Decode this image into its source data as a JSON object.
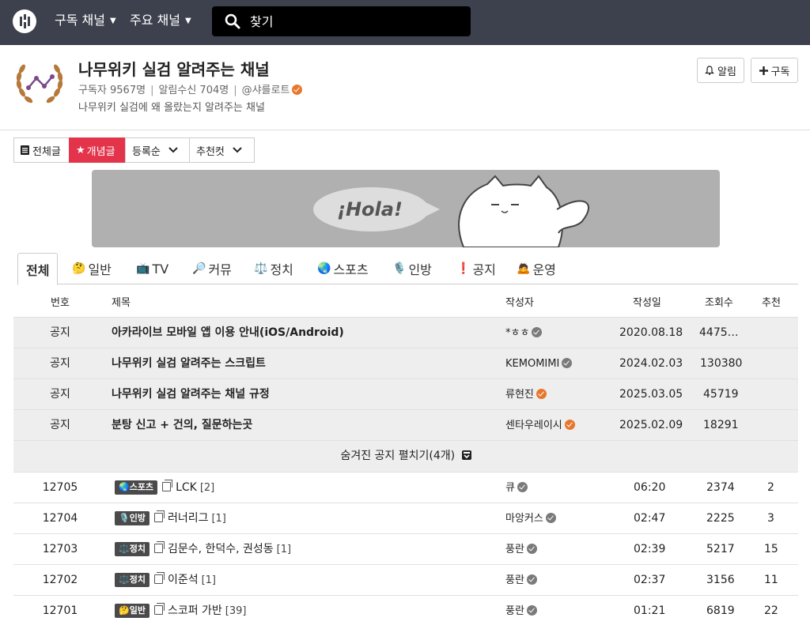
{
  "nav": {
    "menu1": "구독 채널",
    "menu2": "주요 채널",
    "search_placeholder": "찾기"
  },
  "channel": {
    "title": "나무위키 실검 알려주는 채널",
    "subscribers": "구독자 9567명",
    "notify_count": "알림수신 704명",
    "owner": "@샤를로트",
    "description": "나무위키 실검에 왜 올랐는지 알려주는 채널",
    "alert_label": "알림",
    "subscribe_label": "구독"
  },
  "filters": {
    "all": "전체글",
    "best": "개념글",
    "sort": "등록순",
    "recommend": "추천컷"
  },
  "banner": {
    "text": "¡Hola!"
  },
  "tabs": [
    {
      "label": "전체",
      "icon": ""
    },
    {
      "label": "일반",
      "icon": "🤔"
    },
    {
      "label": "TV",
      "icon": "📺"
    },
    {
      "label": "커뮤",
      "icon": "🔎"
    },
    {
      "label": "정치",
      "icon": "⚖️"
    },
    {
      "label": "스포츠",
      "icon": "🌏"
    },
    {
      "label": "인방",
      "icon": "🎙️"
    },
    {
      "label": "공지",
      "icon": "❗"
    },
    {
      "label": "운영",
      "icon": "🙇"
    }
  ],
  "table": {
    "headers": {
      "no": "번호",
      "title": "제목",
      "author": "작성자",
      "date": "작성일",
      "views": "조회수",
      "votes": "추천"
    },
    "notices": [
      {
        "tag": "공지",
        "title": "아카라이브 모바일 앱 이용 안내(iOS/Android)",
        "author": "*ㅎㅎ",
        "date": "2020.08.18",
        "views": "4475…",
        "votes": ""
      },
      {
        "tag": "공지",
        "title": "나무위키 실검 알려주는 스크립트",
        "author": "KEMOMIMI",
        "date": "2024.02.03",
        "views": "130380",
        "votes": ""
      },
      {
        "tag": "공지",
        "title": "나무위키 실검 알려주는 채널 규정",
        "author": "류현진",
        "date": "2025.03.05",
        "views": "45719",
        "votes": ""
      },
      {
        "tag": "공지",
        "title": "분탕 신고 + 건의, 질문하는곳",
        "author": "센타우레이시",
        "date": "2025.02.09",
        "views": "18291",
        "votes": ""
      }
    ],
    "expand_label": "숨겨진 공지 펼치기(4개)",
    "posts": [
      {
        "no": "12705",
        "category": "🌏스포츠",
        "title": "LCK",
        "comments": "[2]",
        "author": "큐",
        "date": "06:20",
        "views": "2374",
        "votes": "2"
      },
      {
        "no": "12704",
        "category": "🎙️인방",
        "title": "러너리그",
        "comments": "[1]",
        "author": "마앙커스",
        "date": "02:47",
        "views": "2225",
        "votes": "3"
      },
      {
        "no": "12703",
        "category": "⚖️정치",
        "title": "김문수, 한덕수, 권성동",
        "comments": "[1]",
        "author": "풍란",
        "date": "02:39",
        "views": "5217",
        "votes": "15"
      },
      {
        "no": "12702",
        "category": "⚖️정치",
        "title": "이준석",
        "comments": "[1]",
        "author": "풍란",
        "date": "02:37",
        "views": "3156",
        "votes": "11"
      },
      {
        "no": "12701",
        "category": "🤔일반",
        "title": "스코퍼 가반",
        "comments": "[39]",
        "author": "풍란",
        "date": "01:21",
        "views": "6819",
        "votes": "22"
      }
    ]
  }
}
